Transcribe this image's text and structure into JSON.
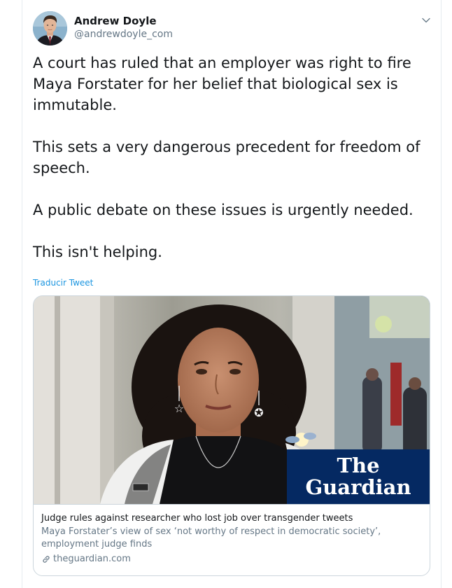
{
  "tweet": {
    "author": {
      "display_name": "Andrew Doyle",
      "handle": "@andrewdoyle_com"
    },
    "menu_icon": "chevron-down-icon",
    "paragraphs": [
      "A court has ruled that an employer was right to fire Maya Forstater for her belief that biological sex is immutable.",
      "This sets a very dangerous precedent for freedom of speech.",
      "A public debate on these issues is urgently needed.",
      "This isn't helping."
    ],
    "translate_label": "Traducir Tweet",
    "link_color": "#1b95e0"
  },
  "card": {
    "image_logo": {
      "line1": "The",
      "line2": "Guardian"
    },
    "title": "Judge rules against researcher who lost job over transgender tweets",
    "description": "Maya Forstater’s view of sex ‘not worthy of respect in democratic society’, employment judge finds",
    "domain": "theguardian.com",
    "link_icon": "link-icon",
    "logo_background": "#052962"
  }
}
